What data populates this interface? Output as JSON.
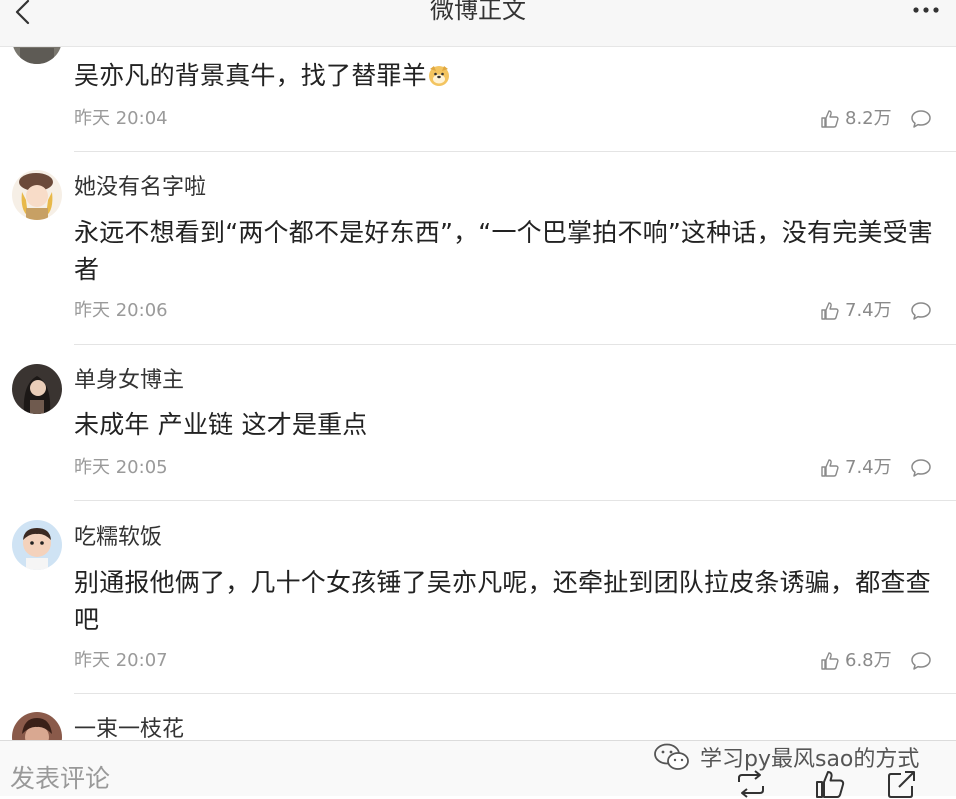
{
  "header": {
    "title": "微博正文",
    "back_icon": "chevron-left-icon",
    "more_icon": "more-horizontal-icon"
  },
  "comments": [
    {
      "username": "",
      "text": "吴亦凡的背景真牛，找了替罪羊",
      "emoji": "doge-emoji-icon",
      "time": "昨天 20:04",
      "likes": "8.2万"
    },
    {
      "username": "她没有名字啦",
      "text": "永远不想看到“两个都不是好东西”，“一个巴掌拍不响”这种话，没有完美受害者",
      "time": "昨天 20:06",
      "likes": "7.4万"
    },
    {
      "username": "单身女博主",
      "text": "未成年 产业链 这才是重点",
      "time": "昨天 20:05",
      "likes": "7.4万"
    },
    {
      "username": "吃糯软饭",
      "text": "别通报他俩了，几十个女孩锤了吴亦凡呢，还牵扯到团队拉皮条诱骗，都查查吧",
      "time": "昨天 20:07",
      "likes": "6.8万"
    },
    {
      "username": "一束一枝花",
      "text": "",
      "time": "",
      "likes": ""
    }
  ],
  "bottom_bar": {
    "placeholder": "发表评论",
    "watermark": "学习py最风sao的方式",
    "icons": [
      "repost-icon",
      "like-icon",
      "share-icon"
    ]
  },
  "colors": {
    "text": "#222222",
    "muted": "#9a9a9a",
    "header_bg": "#f7f7f7",
    "divider": "#e4e4e4"
  }
}
